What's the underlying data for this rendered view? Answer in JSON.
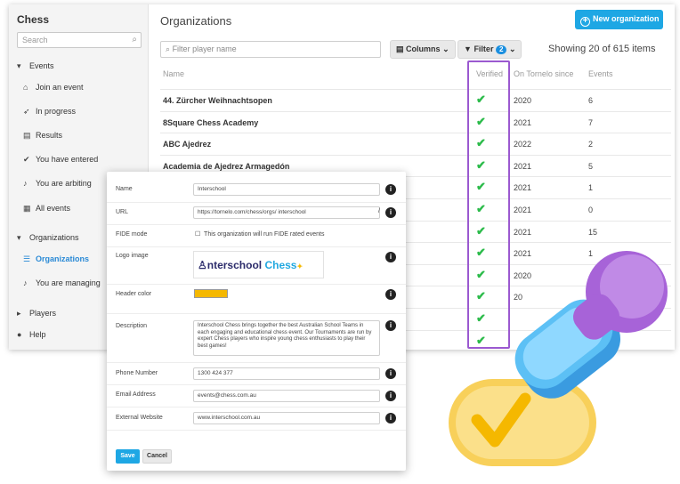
{
  "sidebar": {
    "brand": "Chess",
    "search_placeholder": "Search",
    "events_header": "Events",
    "events_items": [
      {
        "icon": "home-icon",
        "label": "Join an event"
      },
      {
        "icon": "rocket-icon",
        "label": "In progress"
      },
      {
        "icon": "document-icon",
        "label": "Results"
      },
      {
        "icon": "check-icon",
        "label": "You have entered"
      },
      {
        "icon": "whistle-icon",
        "label": "You are arbiting"
      },
      {
        "icon": "calendar-icon",
        "label": "All events"
      }
    ],
    "organizations_header": "Organizations",
    "organizations_items": [
      {
        "icon": "list-icon",
        "label": "Organizations"
      },
      {
        "icon": "whistle-icon",
        "label": "You are managing"
      }
    ],
    "players_header": "Players",
    "help_label": "Help"
  },
  "main": {
    "title": "Organizations",
    "new_button": "New organization",
    "filter_placeholder": "Filter player name",
    "columns_button": "Columns",
    "filter_button": "Filter",
    "filter_count": "2",
    "showing": "Showing 20 of 615 items",
    "columns": {
      "name": "Name",
      "verified": "Verified",
      "since": "On Tornelo since",
      "events": "Events"
    },
    "rows": [
      {
        "name": "44. Zürcher Weihnachtsopen",
        "since": "2020",
        "events": "6"
      },
      {
        "name": "8Square Chess Academy",
        "since": "2021",
        "events": "7"
      },
      {
        "name": "ABC Ajedrez",
        "since": "2022",
        "events": "2"
      },
      {
        "name": "Academia de Ajedrez Armagedón",
        "since": "2021",
        "events": "5"
      },
      {
        "name": "",
        "since": "2021",
        "events": "1"
      },
      {
        "name": "",
        "since": "2021",
        "events": "0"
      },
      {
        "name": "",
        "since": "2021",
        "events": "15"
      },
      {
        "name": "",
        "since": "2021",
        "events": "1"
      },
      {
        "name": "",
        "since": "2020",
        "events": ""
      },
      {
        "name": "",
        "since": "20",
        "events": ""
      },
      {
        "name": "",
        "since": "",
        "events": ""
      },
      {
        "name": "",
        "since": "",
        "events": ""
      }
    ],
    "check_glyph": "✔"
  },
  "modal": {
    "name_label": "Name",
    "name_value": "Interschool",
    "url_label": "URL",
    "url_value": "https://tornelo.com/chess/orgs/ interschool",
    "url_suffix": "/",
    "fide_label": "FIDE mode",
    "fide_text": "This organization will run FIDE rated events",
    "logo_label": "Logo image",
    "logo_text_a": "nterschool",
    "logo_text_b": "Chess",
    "header_color_label": "Header color",
    "header_color": "#f5b800",
    "description_label": "Description",
    "description_value": "Interschool Chess brings together the best Australian School Teams in each engaging and educational chess event. Our Tournaments are run by expert Chess players who inspire young chess enthusiasts to play their best games!",
    "phone_label": "Phone Number",
    "phone_value": "1300 424 377",
    "email_label": "Email Address",
    "email_value": "events@chess.com.au",
    "website_label": "External Website",
    "website_value": "www.interschool.com.au",
    "save": "Save",
    "cancel": "Cancel"
  },
  "colors": {
    "accent": "#1ea7e4",
    "verified_highlight": "#9b59d0",
    "check": "#2bbb4a"
  }
}
